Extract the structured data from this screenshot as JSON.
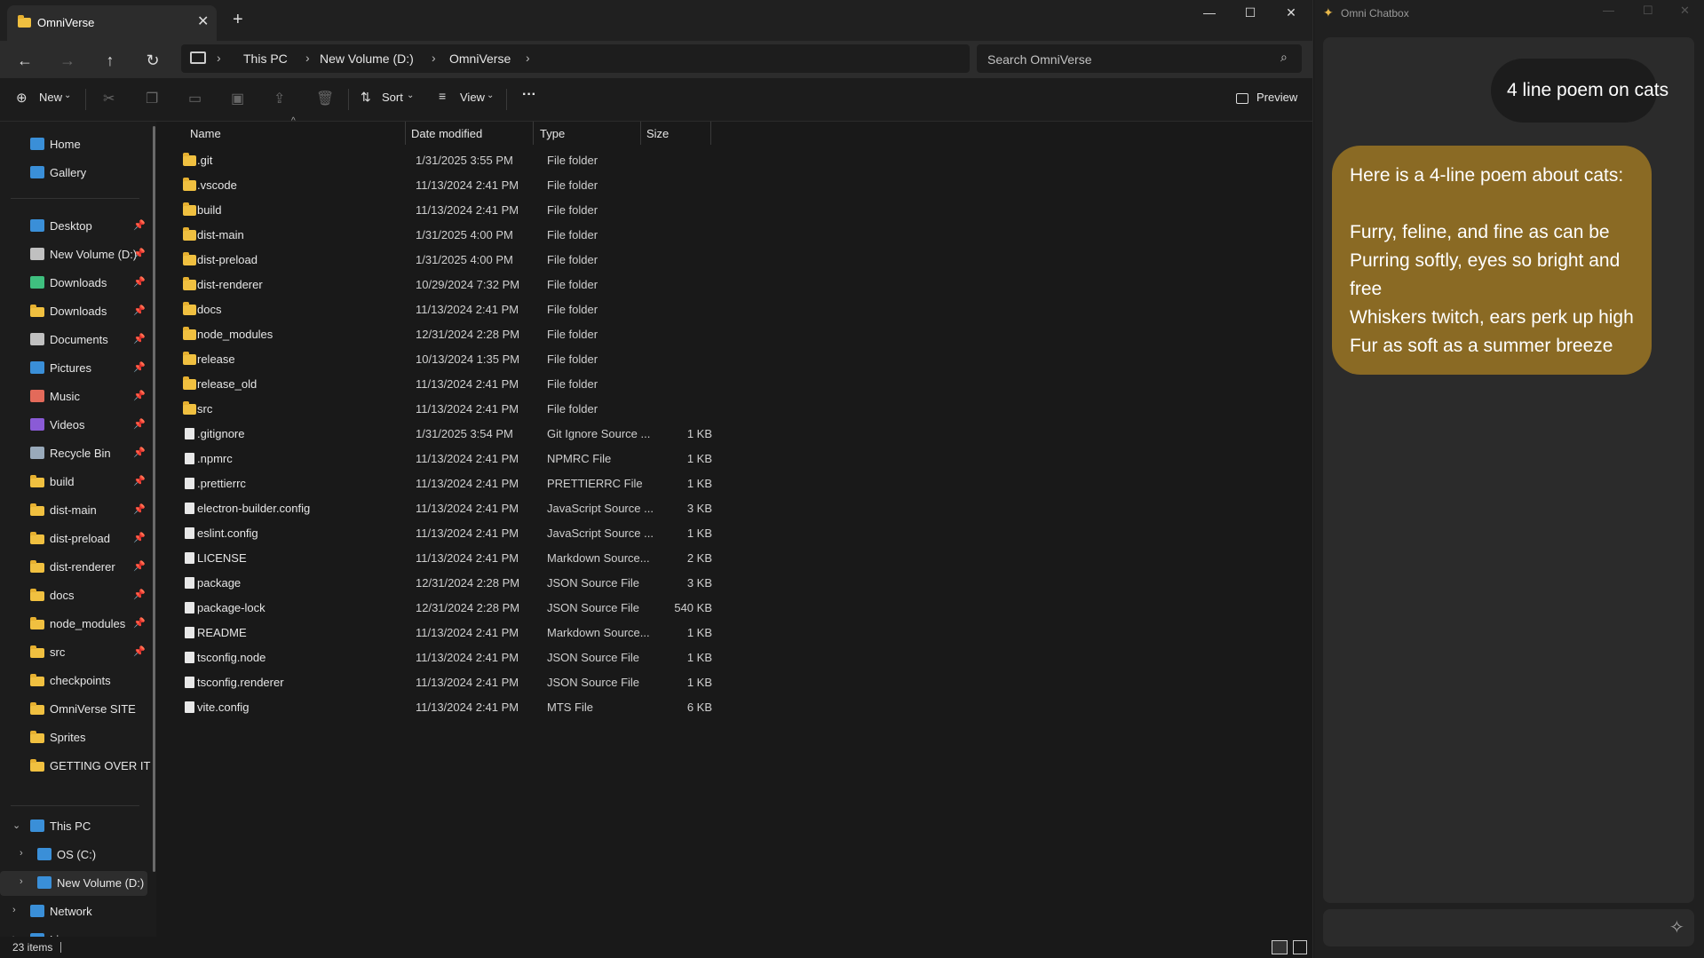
{
  "explorer": {
    "tab_title": "OmniVerse",
    "breadcrumb": [
      "This PC",
      "New Volume (D:)",
      "OmniVerse"
    ],
    "search_placeholder": "Search OmniVerse",
    "toolbar": {
      "new": "New",
      "sort": "Sort",
      "view": "View",
      "more": "···",
      "preview": "Preview"
    },
    "sidebar": {
      "top": [
        {
          "label": "Home",
          "icon": "home-icon"
        },
        {
          "label": "Gallery",
          "icon": "gallery-icon"
        }
      ],
      "pinned": [
        {
          "label": "Desktop",
          "icon": "desktop-icon",
          "color": "#3a8fd8"
        },
        {
          "label": "New Volume (D:)",
          "icon": "drive-icon",
          "color": "#c0c0c0"
        },
        {
          "label": "Downloads",
          "icon": "download-icon",
          "color": "#3fbf7f"
        },
        {
          "label": "Downloads",
          "icon": "folder-icon",
          "color": "#f0c040"
        },
        {
          "label": "Documents",
          "icon": "documents-icon",
          "color": "#c0c0c0"
        },
        {
          "label": "Pictures",
          "icon": "pictures-icon",
          "color": "#3a8fd8"
        },
        {
          "label": "Music",
          "icon": "music-icon",
          "color": "#e36a5a"
        },
        {
          "label": "Videos",
          "icon": "videos-icon",
          "color": "#8a5bd6"
        },
        {
          "label": "Recycle Bin",
          "icon": "recycle-bin-icon",
          "color": "#9ab"
        },
        {
          "label": "build",
          "icon": "folder-icon",
          "color": "#f0c040"
        },
        {
          "label": "dist-main",
          "icon": "folder-icon",
          "color": "#f0c040"
        },
        {
          "label": "dist-preload",
          "icon": "folder-icon",
          "color": "#f0c040"
        },
        {
          "label": "dist-renderer",
          "icon": "folder-icon",
          "color": "#f0c040"
        },
        {
          "label": "docs",
          "icon": "folder-icon",
          "color": "#f0c040"
        },
        {
          "label": "node_modules",
          "icon": "folder-icon",
          "color": "#f0c040"
        },
        {
          "label": "src",
          "icon": "folder-icon",
          "color": "#f0c040"
        }
      ],
      "recent": [
        {
          "label": "checkpoints"
        },
        {
          "label": "OmniVerse SITE"
        },
        {
          "label": "Sprites"
        },
        {
          "label": "GETTING OVER IT"
        }
      ],
      "tree": [
        {
          "label": "This PC",
          "icon": "this-pc-icon"
        },
        {
          "label": "OS (C:)",
          "icon": "drive-icon"
        },
        {
          "label": "New Volume (D:)",
          "icon": "drive-icon"
        },
        {
          "label": "Network",
          "icon": "network-icon"
        },
        {
          "label": "Linux",
          "icon": "linux-icon"
        }
      ]
    },
    "columns": [
      "Name",
      "Date modified",
      "Type",
      "Size"
    ],
    "files": [
      {
        "name": ".git",
        "date": "1/31/2025 3:55 PM",
        "type": "File folder",
        "size": "",
        "kind": "folder"
      },
      {
        "name": ".vscode",
        "date": "11/13/2024 2:41 PM",
        "type": "File folder",
        "size": "",
        "kind": "folder"
      },
      {
        "name": "build",
        "date": "11/13/2024 2:41 PM",
        "type": "File folder",
        "size": "",
        "kind": "folder"
      },
      {
        "name": "dist-main",
        "date": "1/31/2025 4:00 PM",
        "type": "File folder",
        "size": "",
        "kind": "folder"
      },
      {
        "name": "dist-preload",
        "date": "1/31/2025 4:00 PM",
        "type": "File folder",
        "size": "",
        "kind": "folder"
      },
      {
        "name": "dist-renderer",
        "date": "10/29/2024 7:32 PM",
        "type": "File folder",
        "size": "",
        "kind": "folder"
      },
      {
        "name": "docs",
        "date": "11/13/2024 2:41 PM",
        "type": "File folder",
        "size": "",
        "kind": "folder"
      },
      {
        "name": "node_modules",
        "date": "12/31/2024 2:28 PM",
        "type": "File folder",
        "size": "",
        "kind": "folder"
      },
      {
        "name": "release",
        "date": "10/13/2024 1:35 PM",
        "type": "File folder",
        "size": "",
        "kind": "folder"
      },
      {
        "name": "release_old",
        "date": "11/13/2024 2:41 PM",
        "type": "File folder",
        "size": "",
        "kind": "folder"
      },
      {
        "name": "src",
        "date": "11/13/2024 2:41 PM",
        "type": "File folder",
        "size": "",
        "kind": "folder"
      },
      {
        "name": ".gitignore",
        "date": "1/31/2025 3:54 PM",
        "type": "Git Ignore Source ...",
        "size": "1 KB",
        "kind": "file"
      },
      {
        "name": ".npmrc",
        "date": "11/13/2024 2:41 PM",
        "type": "NPMRC File",
        "size": "1 KB",
        "kind": "file"
      },
      {
        "name": ".prettierrc",
        "date": "11/13/2024 2:41 PM",
        "type": "PRETTIERRC File",
        "size": "1 KB",
        "kind": "file"
      },
      {
        "name": "electron-builder.config",
        "date": "11/13/2024 2:41 PM",
        "type": "JavaScript Source ...",
        "size": "3 KB",
        "kind": "file"
      },
      {
        "name": "eslint.config",
        "date": "11/13/2024 2:41 PM",
        "type": "JavaScript Source ...",
        "size": "1 KB",
        "kind": "file"
      },
      {
        "name": "LICENSE",
        "date": "11/13/2024 2:41 PM",
        "type": "Markdown Source...",
        "size": "2 KB",
        "kind": "file"
      },
      {
        "name": "package",
        "date": "12/31/2024 2:28 PM",
        "type": "JSON Source File",
        "size": "3 KB",
        "kind": "file"
      },
      {
        "name": "package-lock",
        "date": "12/31/2024 2:28 PM",
        "type": "JSON Source File",
        "size": "540 KB",
        "kind": "file"
      },
      {
        "name": "README",
        "date": "11/13/2024 2:41 PM",
        "type": "Markdown Source...",
        "size": "1 KB",
        "kind": "file"
      },
      {
        "name": "tsconfig.node",
        "date": "11/13/2024 2:41 PM",
        "type": "JSON Source File",
        "size": "1 KB",
        "kind": "file"
      },
      {
        "name": "tsconfig.renderer",
        "date": "11/13/2024 2:41 PM",
        "type": "JSON Source File",
        "size": "1 KB",
        "kind": "file"
      },
      {
        "name": "vite.config",
        "date": "11/13/2024 2:41 PM",
        "type": "MTS File",
        "size": "6 KB",
        "kind": "file"
      }
    ],
    "status": "23 items"
  },
  "chat": {
    "title": "Omni Chatbox",
    "user_message": "4 line poem on cats",
    "bot_lines": [
      "Here is a 4-line poem about cats:",
      "",
      "Furry, feline, and fine as can be",
      "Purring softly, eyes so bright and",
      "free",
      "Whiskers twitch, ears perk up high",
      "Fur as soft as a summer breeze"
    ],
    "accent_color": "#8a6a24"
  }
}
